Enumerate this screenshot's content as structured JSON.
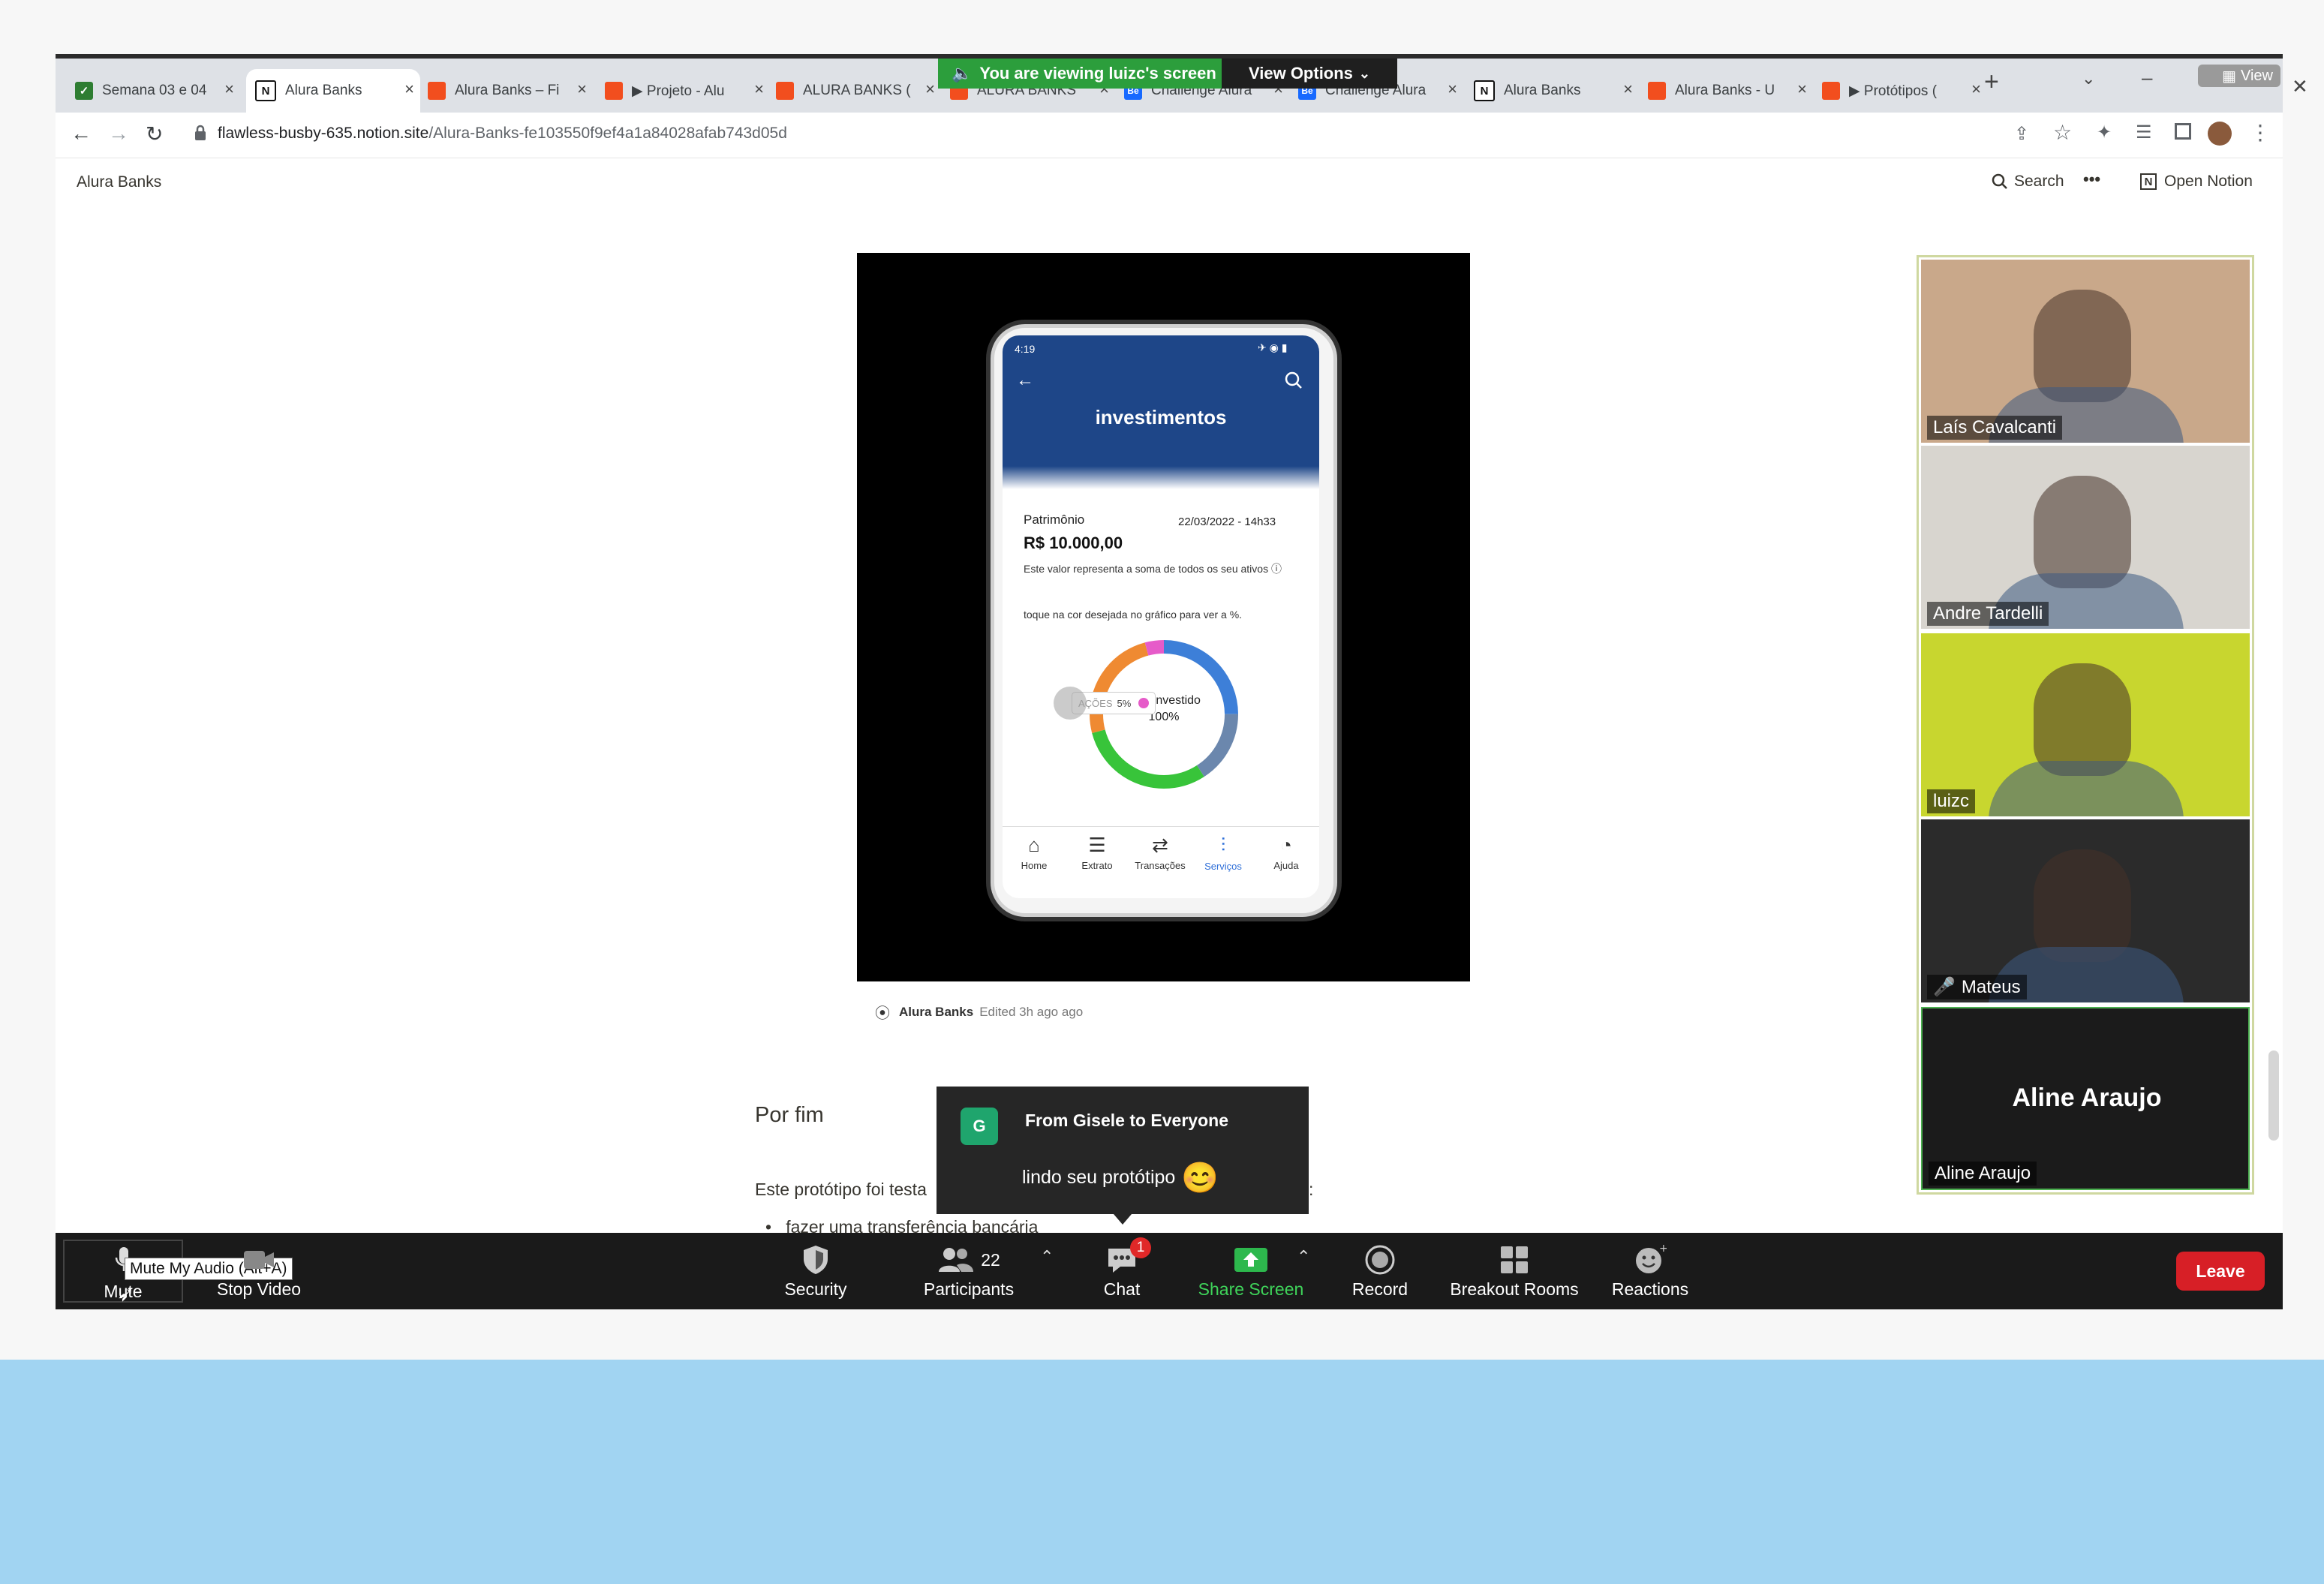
{
  "browser": {
    "tabs": [
      {
        "title": "Semana 03 e 04",
        "icon": "shield-icon",
        "color": "#2e7d32"
      },
      {
        "title": "Alura Banks",
        "icon": "notion-icon",
        "active": true
      },
      {
        "title": "Alura Banks – Fi",
        "icon": "figma-icon"
      },
      {
        "title": "▶ Projeto - Alu",
        "icon": "figma-icon"
      },
      {
        "title": "ALURA BANKS (",
        "icon": "figma-icon"
      },
      {
        "title": "ALURA BANKS",
        "icon": "figma-icon"
      },
      {
        "title": "Challenge Alura",
        "icon": "behance-icon"
      },
      {
        "title": "Challenge Alura",
        "icon": "behance-icon"
      },
      {
        "title": "Alura Banks",
        "icon": "notion-icon"
      },
      {
        "title": "Alura Banks - U",
        "icon": "figma-icon"
      },
      {
        "title": "▶ Protótipos (",
        "icon": "figma-icon"
      }
    ],
    "new_tab": "+",
    "view_label": "View",
    "url_host": "flawless-busby-635.notion.site",
    "url_path": "/Alura-Banks-fe103550f9ef4a1a84028afab743d05d"
  },
  "zoom_banner": {
    "viewing": "You are viewing luizc's screen",
    "view_options": "View Options"
  },
  "notion": {
    "breadcrumb": "Alura Banks",
    "search": "Search",
    "more": "•••",
    "open_notion": "Open Notion",
    "embed_source": "Alura Banks",
    "embed_edited": "Edited 3h ago ago",
    "heading": "Por fim",
    "paragraph_visible": "Este protótipo foi testa",
    "paragraph_tail": ":",
    "bullet_1": "fazer uma transferência bancária"
  },
  "phone": {
    "time": "4:19",
    "title": "investimentos",
    "patrimonio_label": "Patrimônio",
    "date": "22/03/2022 - 14h33",
    "amount": "R$ 10.000,00",
    "description": "Este valor representa a soma de todos os seu ativos",
    "hint": "toque na cor desejada no gráfico para ver a %.",
    "donut_label": "total investido",
    "donut_value": "100%",
    "tooltip_label": "AÇÕES",
    "tooltip_value": "5%",
    "nav": [
      "Home",
      "Extrato",
      "Transações",
      "Serviços",
      "Ajuda"
    ],
    "active_nav": "Serviços"
  },
  "participants_video": [
    {
      "name": "Laís Cavalcanti",
      "bg": "#c9a88a"
    },
    {
      "name": "Andre Tardelli",
      "bg": "#d8d5cf"
    },
    {
      "name": "luizc",
      "bg": "#c8d62f"
    },
    {
      "name": "Mateus",
      "bg": "#2b2b2b",
      "muted": true
    },
    {
      "name": "Aline Araujo",
      "bg": "#1b1b1b",
      "center_name": "Aline Araujo"
    }
  ],
  "chat_popup": {
    "avatar_letter": "G",
    "from": "From Gisele to Everyone",
    "message": "lindo seu protótipo",
    "emoji": "😊"
  },
  "toolbar": {
    "mute": "Mute",
    "mute_tooltip": "Mute My Audio (Alt+A)",
    "stop_video": "Stop Video",
    "security": "Security",
    "participants": "Participants",
    "participants_count": "22",
    "chat": "Chat",
    "chat_badge": "1",
    "share_screen": "Share Screen",
    "record": "Record",
    "breakout_rooms": "Breakout Rooms",
    "reactions": "Reactions",
    "leave": "Leave"
  },
  "colors": {
    "zoom_green": "#2c9e3c",
    "leave_red": "#d71f26",
    "app_blue": "#1e4688",
    "donut_blue": "#3d7fd8",
    "donut_green": "#38c43a",
    "donut_orange": "#ef8a32",
    "donut_gray": "#6b87ad",
    "light_blue_band": "#a1d4f2"
  }
}
